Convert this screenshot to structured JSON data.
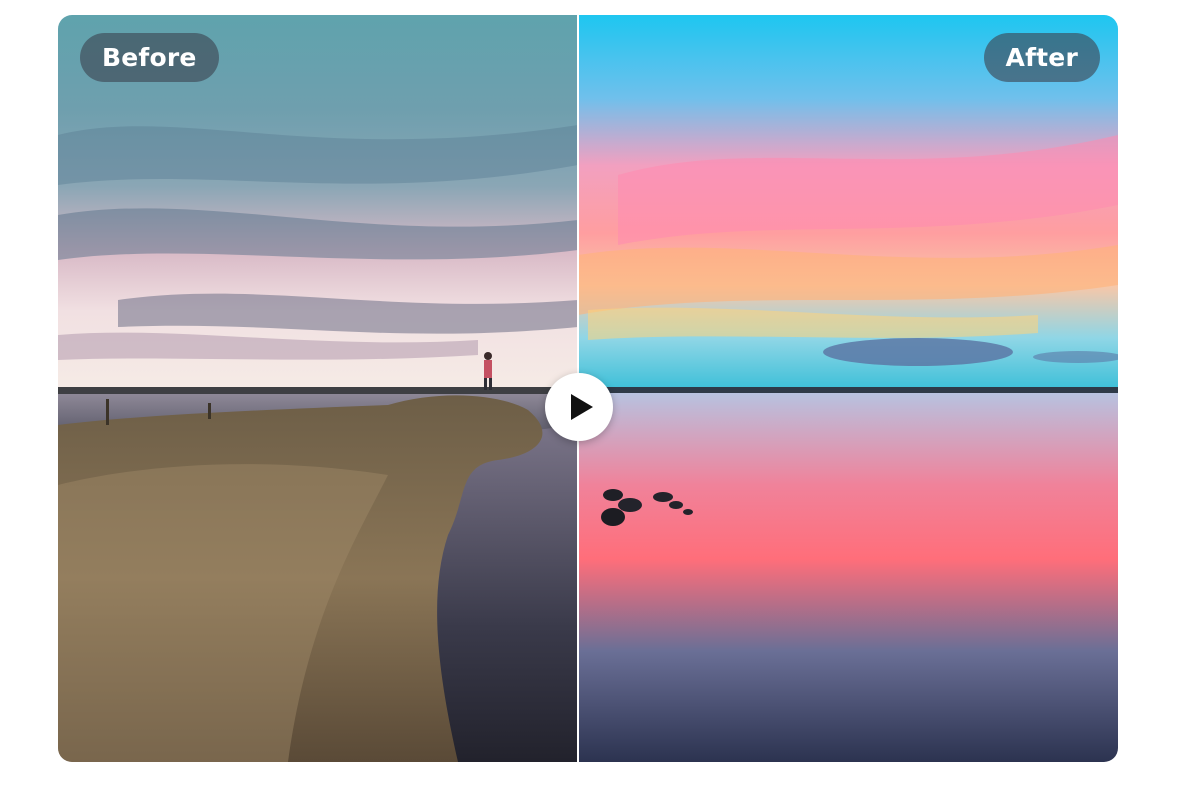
{
  "comparison": {
    "before_label": "Before",
    "after_label": "After",
    "slider_position_fraction": 0.49,
    "handle_icon": "play-icon"
  },
  "colors": {
    "label_background": "#3c4450",
    "label_text": "#ffffff",
    "divider": "#ffffff",
    "handle_background": "#ffffff",
    "handle_icon": "#111111"
  }
}
